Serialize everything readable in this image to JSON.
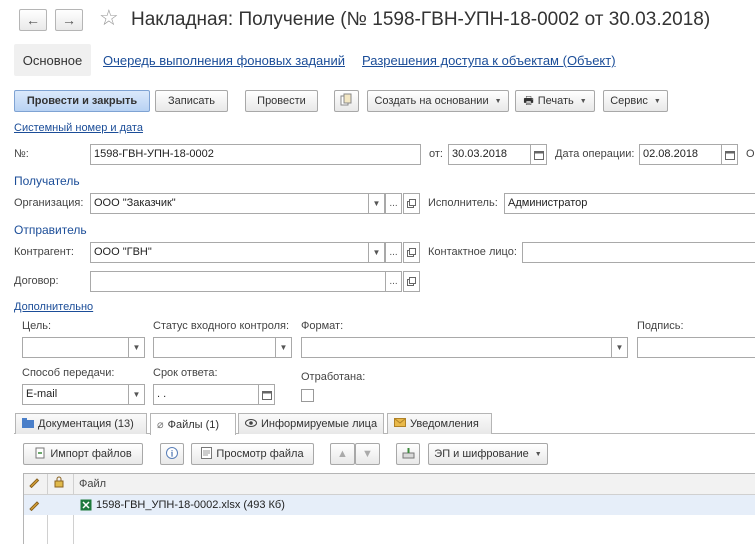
{
  "window": {
    "title": "Накладная: Получение (№ 1598-ГВН-УПН-18-0002 от 30.03.2018)",
    "back_icon": "←",
    "forward_icon": "→",
    "star_icon": "☆"
  },
  "nav_tabs": {
    "main": "Основное",
    "queue": "Очередь выполнения фоновых заданий",
    "access": "Разрешения доступа к объектам (Объект)"
  },
  "toolbar": {
    "post_close": "Провести и закрыть",
    "save": "Записать",
    "post": "Провести",
    "create_based": "Создать на основании",
    "print": "Печать",
    "service": "Сервис"
  },
  "system_number_link": "Системный номер и дата",
  "form": {
    "number_label": "№:",
    "number_value": "1598-ГВН-УПН-18-0002",
    "date_from_label": "от:",
    "date_from_value": "30.03.2018",
    "op_date_label": "Дата операции:",
    "op_date_value": "02.08.2018",
    "cut_label": "О",
    "recipient_group": "Получатель",
    "org_label": "Организация:",
    "org_value": "ООО \"Заказчик\"",
    "executor_label": "Исполнитель:",
    "executor_value": "Администратор",
    "sender_group": "Отправитель",
    "counterparty_label": "Контрагент:",
    "counterparty_value": "ООО \"ГВН\"",
    "contact_label": "Контактное лицо:",
    "contact_value": "",
    "contract_label": "Договор:",
    "contract_value": "",
    "additional_link": "Дополнительно",
    "purpose_label": "Цель:",
    "purpose_value": "",
    "status_label": "Статус входного контроля:",
    "status_value": "",
    "format_label": "Формат:",
    "format_value": "",
    "sign_label": "Подпись:",
    "sign_value": "",
    "transfer_label": "Способ передачи:",
    "transfer_value": "E-mail",
    "response_label": "Срок ответа:",
    "response_value": " .  .",
    "processed_label": "Отработана:"
  },
  "bottom_tabs": [
    {
      "label": "Документация (13)",
      "icon": "folder"
    },
    {
      "label": "Файлы (1)",
      "icon": "paperclip"
    },
    {
      "label": "Информируемые лица",
      "icon": "eye"
    },
    {
      "label": "Уведомления",
      "icon": "envelope"
    }
  ],
  "files_toolbar": {
    "import": "Импорт файлов",
    "preview": "Просмотр файла",
    "sign_encrypt": "ЭП и шифрование"
  },
  "files_table": {
    "column_file": "Файл",
    "rows": [
      {
        "name": "1598-ГВН_УПН-18-0002.xlsx (493 Кб)"
      }
    ]
  },
  "colors": {
    "link": "#1b4d98",
    "primary_button": "#b8d2f3",
    "selected_row": "#e6eef9"
  }
}
